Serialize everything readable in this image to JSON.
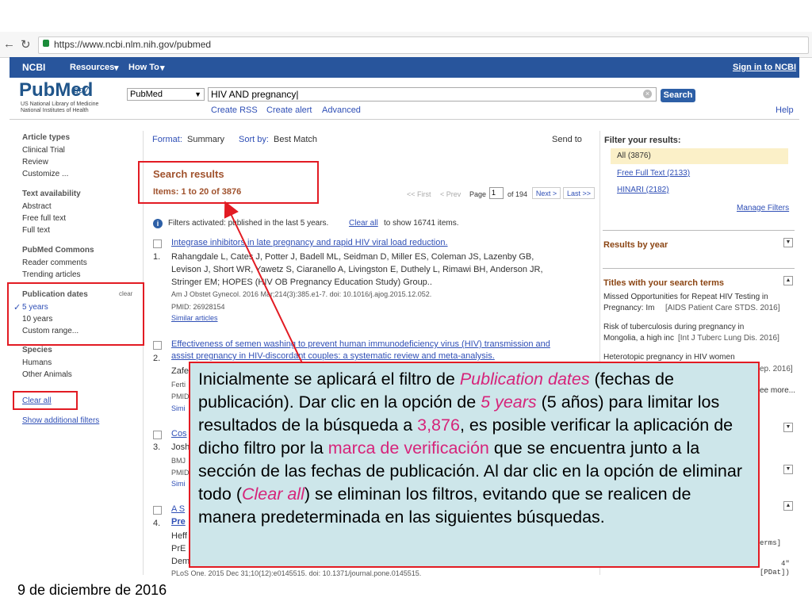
{
  "browser": {
    "url": "https://www.ncbi.nlm.nih.gov/pubmed"
  },
  "ncbi": {
    "logo": "NCBI",
    "resources": "Resources",
    "howto": "How To",
    "signin": "Sign in to NCBI"
  },
  "header": {
    "logo_pub": "PubMed",
    "logo_gov": ".gov",
    "logo_sub1": "US National Library of Medicine",
    "logo_sub2": "National Institutes of Health",
    "db": "PubMed",
    "query": "HIV AND pregnancy",
    "search_label": "Search",
    "create_rss": "Create RSS",
    "create_alert": "Create alert",
    "advanced": "Advanced",
    "help": "Help"
  },
  "left": {
    "article_types": "Article types",
    "clinical_trial": "Clinical Trial",
    "review": "Review",
    "customize": "Customize ...",
    "text_availability": "Text availability",
    "abstract": "Abstract",
    "free_full_text": "Free full text",
    "full_text": "Full text",
    "commons": "PubMed Commons",
    "reader_comments": "Reader comments",
    "trending": "Trending articles",
    "pub_dates": "Publication dates",
    "clear": "clear",
    "five_years": "5 years",
    "ten_years": "10 years",
    "custom_range": "Custom range...",
    "species": "Species",
    "humans": "Humans",
    "other_animals": "Other Animals",
    "clear_all": "Clear all",
    "show_filters": "Show additional filters"
  },
  "main": {
    "format_label": "Format:",
    "format_value": "Summary",
    "sort_label": "Sort by:",
    "sort_value": "Best Match",
    "send_to": "Send to",
    "search_results": "Search results",
    "items": "Items: 1 to 20 of 3876",
    "first": "<< First",
    "prev": "< Prev",
    "page_label": "Page",
    "page": "1",
    "of_pages": "of 194",
    "next": "Next >",
    "last": "Last >>",
    "filters_activated": "Filters activated: published in the last 5 years.",
    "clear_all_link": "Clear all",
    "filters_rest": "to show 16741 items.",
    "r1_num": "1.",
    "r1_title": "Integrase inhibitors in late pregnancy and rapid HIV viral load reduction.",
    "r1_a1": "Rahangdale L, Cates J, Potter J, Badell ML, Seidman D, Miller ES, Coleman JS, Lazenby GB,",
    "r1_a2": "Levison J, Short WR, Yawetz S, Ciaranello A, Livingston E, Duthely L, Rimawi BH, Anderson JR,",
    "r1_a3": "Stringer EM; HOPES (HIV OB Pregnancy Education Study) Group..",
    "r1_j": "Am J Obstet Gynecol. 2016 Mar;214(3):385.e1-7. doi: 10.1016/j.ajog.2015.12.052.",
    "r1_pmid": "PMID: 26928154",
    "similar": "Similar articles",
    "r2_num": "2.",
    "r2_t1": "Effectiveness of semen washing to prevent human immunodeficiency virus (HIV) transmission and",
    "r2_t2": "assist pregnancy in HIV-discordant couples: a systematic review and meta-analysis.",
    "r2_a": "Zafe",
    "r2_j": "Ferti",
    "r2_p": "PMID",
    "r2_s": "Simi",
    "r3_t": "Cos",
    "r3_num": "3.",
    "r3_a": "Josh",
    "r3_j": "BMJ",
    "r3_p": "PMID",
    "r3_s": "Simi",
    "r4_t": "A S",
    "r4_num": "4.",
    "r4_t2": "Pre",
    "r4_a": "Heff",
    "r4_b": "PrE",
    "r4_c": "Dem",
    "r4_j": "PLoS One. 2015 Dec 31;10(12):e0145515. doi: 10.1371/journal.pone.0145515."
  },
  "right": {
    "filter_title": "Filter your results:",
    "all": "All (3876)",
    "free_full_text": "Free Full Text (2133)",
    "hinari": "HINARI (2182)",
    "manage": "Manage Filters",
    "results_by_year": "Results by year",
    "titles_terms": "Titles with your search terms",
    "t1a": "Missed Opportunities for Repeat HIV Testing in",
    "t1b": "Pregnancy: Im",
    "t1c": "[AIDS Patient Care STDS. 2016]",
    "t2a": "Risk of tuberculosis during pregnancy in",
    "t2b": "Mongolia, a high inc",
    "t2c": "[Int J Tuberc Lung Dis. 2016]",
    "t3a": "Heterotopic pregnancy in HIV women",
    "t3c": "ep. 2016]",
    "see_more": "ee more...",
    "terms": "erms]",
    "pdat_a": "4\"",
    "pdat_b": "[PDat])"
  },
  "annotation": {
    "p1": "Inicialmente se aplicará el filtro de ",
    "p1_pink": "Publication dates",
    "p2": " (fechas de publicación). Dar clic en la opción de ",
    "p2_pink": "5 years",
    "p3": " (5 años) para limitar los resultados de la búsqueda a ",
    "p3_pink": "3,876",
    "p4": ", es posible verificar la aplicación de dicho filtro por la ",
    "p4_pink": "marca de verificación",
    "p5": " que se encuentra junto a la sección de las fechas de publicación. Al dar clic en la opción de eliminar todo (",
    "p5_pink": "Clear all",
    "p6": ") se eliminan los filtros, evitando que se realicen de manera predeterminada en las siguientes búsquedas."
  },
  "footer": {
    "date": "9 de diciembre de 2016"
  },
  "colors": {
    "ncbi_bar": "#28559c",
    "link": "#2f4fb6",
    "highlight_red": "#e21b23",
    "callout_bg": "#cde6ea",
    "pink": "#d6247a"
  }
}
